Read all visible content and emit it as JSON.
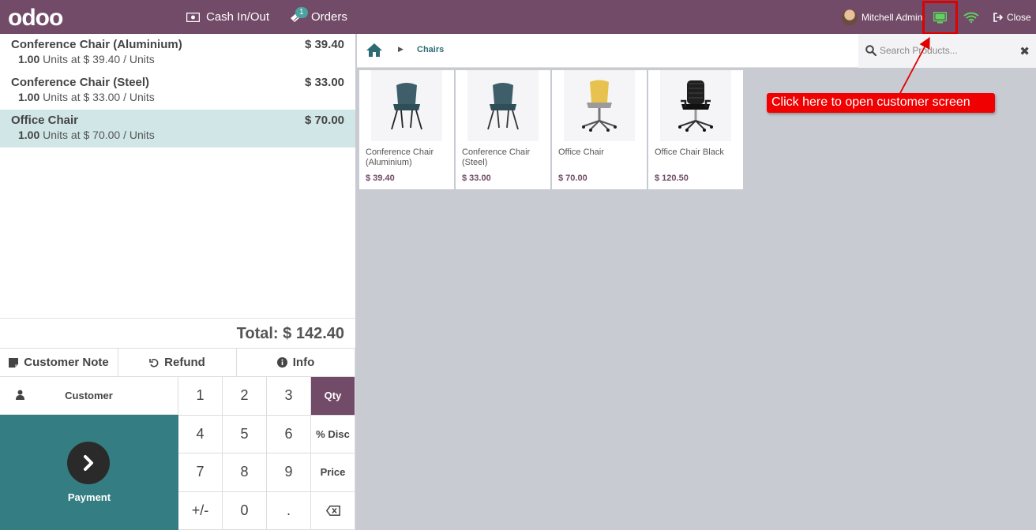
{
  "topbar": {
    "logo": "odoo",
    "cash_label": "Cash In/Out",
    "orders_label": "Orders",
    "orders_badge": "1",
    "user_name": "Mitchell Admin",
    "close_label": "Close"
  },
  "order": {
    "lines": [
      {
        "name": "Conference Chair (Aluminium)",
        "price": "$ 39.40",
        "qty": "1.00",
        "detail": " Units at $ 39.40 / Units"
      },
      {
        "name": "Conference Chair (Steel)",
        "price": "$ 33.00",
        "qty": "1.00",
        "detail": " Units at $ 33.00 / Units"
      },
      {
        "name": "Office Chair",
        "price": "$ 70.00",
        "qty": "1.00",
        "detail": " Units at $ 70.00 / Units"
      }
    ],
    "total": "Total: $ 142.40"
  },
  "controls": {
    "customer_note": "Customer Note",
    "refund": "Refund",
    "info": "Info",
    "customer": "Customer",
    "payment": "Payment"
  },
  "numpad": {
    "keys": [
      "1",
      "2",
      "3",
      "Qty",
      "4",
      "5",
      "6",
      "% Disc",
      "7",
      "8",
      "9",
      "Price",
      "+/-",
      "0",
      "."
    ],
    "active_mode": "Qty"
  },
  "products_panel": {
    "breadcrumb": "Chairs",
    "search_placeholder": "Search Products...",
    "search_clear": "✖",
    "products": [
      {
        "name": "Conference Chair (Aluminium)",
        "price": "$ 39.40"
      },
      {
        "name": "Conference Chair (Steel)",
        "price": "$ 33.00"
      },
      {
        "name": "Office Chair",
        "price": "$ 70.00"
      },
      {
        "name": "Office Chair Black",
        "price": "$ 120.50"
      }
    ]
  },
  "annotation": {
    "text": "Click here to open customer screen"
  },
  "colors": {
    "brand": "#714b67",
    "payment": "#347e83",
    "selected_line": "#d1e6e6",
    "annotation": "#f00000"
  }
}
